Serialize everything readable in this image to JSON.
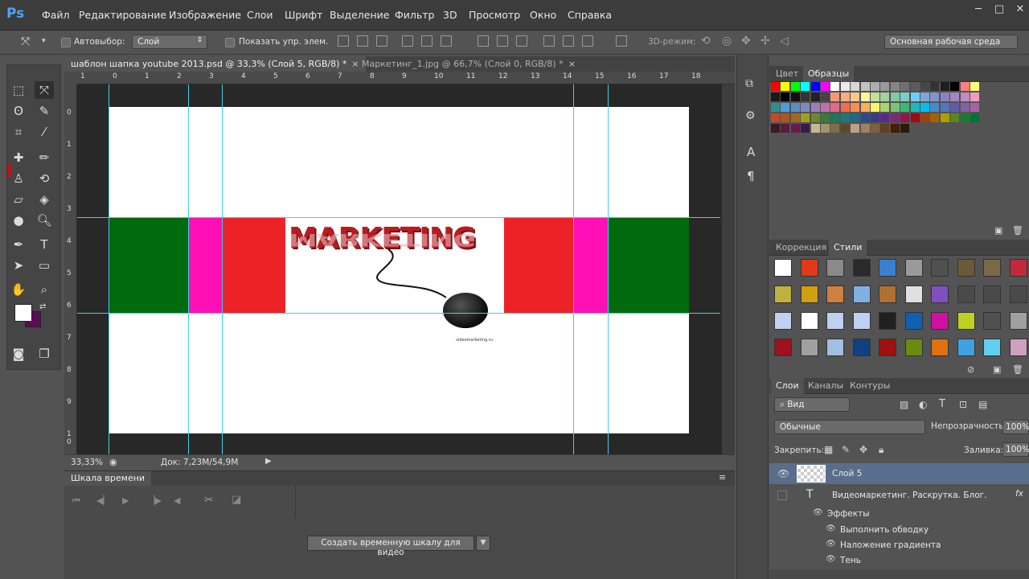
{
  "app": {
    "logo": "Ps"
  },
  "menu": [
    "Файл",
    "Редактирование",
    "Изображение",
    "Слои",
    "Шрифт",
    "Выделение",
    "Фильтр",
    "3D",
    "Просмотр",
    "Окно",
    "Справка"
  ],
  "window_controls": [
    "─",
    "□",
    "✕"
  ],
  "options": {
    "auto_select_label": "Автовыбор:",
    "auto_select_value": "Слой",
    "show_transform": "Показать упр. элем.",
    "mode_3d": "3D-режим:",
    "workspace": "Основная рабочая среда"
  },
  "tabs": [
    {
      "label": "шаблон шапка youtube 2013.psd @ 33,3% (Слой 5, RGB/8) *",
      "close": "×"
    },
    {
      "label": "Маркетинг_1.jpg @ 66,7% (Слой 0, RGB/8) *",
      "close": "×"
    }
  ],
  "ruler_h": [
    "1",
    "0",
    "1",
    "2",
    "3",
    "4",
    "5",
    "6",
    "7",
    "8",
    "9",
    "10",
    "11",
    "12",
    "13",
    "14",
    "15",
    "16",
    "17",
    "18"
  ],
  "ruler_v": [
    "0",
    "1",
    "2",
    "3",
    "4",
    "5",
    "6",
    "7",
    "8",
    "9",
    "1 0"
  ],
  "canvas": {
    "marketing_text": "MARKETING",
    "small_caption": "videomarketing.ru",
    "colors": {
      "green": "#006a0e",
      "magenta": "#ff0fb6",
      "red": "#ec2227",
      "white": "#ffffff",
      "guide": "#3fd0e8"
    }
  },
  "status": {
    "zoom": "33,33%",
    "doc": "Док: 7,23M/54,9M"
  },
  "timeline": {
    "title": "Шкала времени",
    "create_button": "Создать временную шкалу для видео"
  },
  "swatches_panel": {
    "tabs": [
      "Цвет",
      "Образцы"
    ]
  },
  "styles_panel": {
    "tabs": [
      "Коррекция",
      "Стили"
    ]
  },
  "layers_panel": {
    "tabs": [
      "Слои",
      "Каналы",
      "Контуры"
    ],
    "filter": "Вид",
    "blend_mode": "Обычные",
    "opacity_label": "Непрозрачность:",
    "opacity_value": "100%",
    "lock_label": "Закрепить:",
    "fill_label": "Заливка:",
    "fill_value": "100%",
    "layers": [
      {
        "name": "Слой 5",
        "type": "image",
        "selected": true
      },
      {
        "name": "Видеомаркетинг. Раскрутка. Блог.",
        "type": "text",
        "fx": "fx"
      }
    ],
    "effects_label": "Эффекты",
    "effects": [
      "Выполнить обводку",
      "Наложение градиента",
      "Тень"
    ]
  }
}
